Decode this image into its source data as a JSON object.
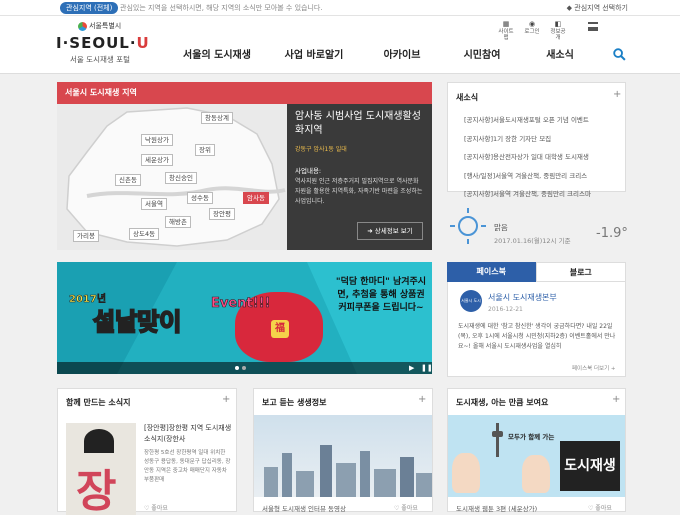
{
  "topbar": {
    "region_pill": "관심지역 (전체)",
    "region_message": "관심있는 지역을 선택하시면, 해당 지역의 소식만 모아볼 수 있습니다.",
    "region_select": "관심지역 선택하기"
  },
  "header": {
    "seal_text": "서울특별시",
    "logo_prefix": "I·SEOUL·",
    "logo_suffix": "U",
    "logo_sub": "서울 도시재생 포털",
    "utils": [
      {
        "icon": "sitemap-icon",
        "glyph": "▦",
        "label": "사이트맵"
      },
      {
        "icon": "login-icon",
        "glyph": "◉",
        "label": "로그인"
      },
      {
        "icon": "info-icon",
        "glyph": "◧",
        "label": "정보공개"
      }
    ],
    "nav": [
      "서울의 도시재생",
      "사업 바로알기",
      "아카이브",
      "시민참여",
      "새소식"
    ]
  },
  "region": {
    "heading": "서울시 도시재생 지역",
    "districts": [
      "창동상계",
      "낙원상가",
      "장위",
      "세운상가",
      "신촌동",
      "창신숭인",
      "성수동",
      "서울역",
      "해방촌",
      "암사동",
      "장안평",
      "가리봉",
      "상도4동"
    ],
    "selected_district": "암사동",
    "info_title": "암사동 시범사업 도시재생활성화지역",
    "info_location": "강동구 암사1동 일대",
    "info_label": "사업내용:",
    "info_desc": "역사지원 인근 저층주거지 밀집지역으로 역사문화자원을 활용한 지역특화, 자족기반 마련을 조성하는 사업입니다.",
    "info_more": "상세정보 보기"
  },
  "banner": {
    "year": "2017년",
    "title": "설날맞이",
    "event": "Event!!!",
    "bag_char": "福",
    "message": "\"덕담 한마디\" 남겨주시면, 추첨을 통해 상품권 커피쿠폰을 드립니다~",
    "prev": "◀",
    "play": "▶",
    "pause": "❚❚"
  },
  "news": {
    "heading": "새소식",
    "items": [
      "[공지사항]서울도시재생포털 오픈 기념 이벤트",
      "[공지사항]1기 장한 기자단 모집",
      "[공지사항]용산전자상가 일대 대학생 도시재생",
      "[행사/일정]서울역 겨울산책, 중림만리 크리스",
      "[공지사항]서울역 겨울산책, 중림만리 크리스마"
    ]
  },
  "weather": {
    "condition": "맑음",
    "date": "2017.01.16(월)12시 기준",
    "temp": "-1.9°"
  },
  "social": {
    "tabs": [
      "페이스북",
      "블로그"
    ],
    "avatar_text": "서울시 도시재생",
    "name": "서울시 도시재생본부",
    "date": "2016-12-21",
    "text": "도시재생에 대한 '참고 참신한' 생각이 궁금하다면? 내일 22일(목), 오후 1시에 서울시청 시민청(지하2층) 이벤트홀에서 만나요~! 올해 서울시 도시재생사업을 열심히",
    "more": "페이스북 더보기 +"
  },
  "bottom": {
    "sections": [
      {
        "title": "함께 만드는 소식지",
        "caption": "[장안평]장한평 지역 도시재생소식지(장한사",
        "text": "장한평 5호선 장한평역 일대 위치한 성동구 용답동, 동대문구 답십리동, 장안동 지역은 중고차 매매단지 자동차 부품판매",
        "like": "좋아요",
        "thumb_char": "장"
      },
      {
        "title": "보고 듣는 생생정보",
        "caption": "서울형 도시재생 인터뷰 동영상",
        "like": "좋아요"
      },
      {
        "title": "도시재생, 아는 만큼 보여요",
        "caption": "도시재생 웹툰 3편 (세운상가)",
        "like": "좋아요",
        "webtoon_banner": "모두가 함께 가는",
        "webtoon_title": "도시재생"
      }
    ]
  },
  "colors": {
    "accent_red": "#d8474e",
    "accent_blue": "#2d5fa8",
    "banner_teal": "#22b0c0"
  }
}
